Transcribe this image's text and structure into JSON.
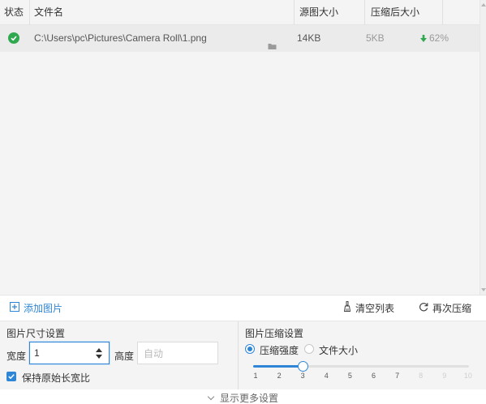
{
  "table": {
    "headers": {
      "status": "状态",
      "filename": "文件名",
      "original_size": "源图大小",
      "compressed_size": "压缩后大小"
    },
    "rows": [
      {
        "status": "success",
        "path": "C:\\Users\\pc\\Pictures\\Camera Roll\\1.png",
        "original_size": "14KB",
        "compressed_size": "5KB",
        "ratio": "62%"
      }
    ]
  },
  "toolbar": {
    "add_label": "添加图片",
    "clear_label": "清空列表",
    "recompress_label": "再次压缩"
  },
  "size_settings": {
    "title": "图片尺寸设置",
    "width_label": "宽度",
    "width_value": "1",
    "height_label": "高度",
    "height_placeholder": "自动",
    "keep_ratio_label": "保持原始长宽比",
    "keep_ratio_checked": true
  },
  "compress_settings": {
    "title": "图片压缩设置",
    "mode_strength_label": "压缩强度",
    "mode_filesize_label": "文件大小",
    "selected_mode": "strength",
    "level_value": 3,
    "levels": [
      "1",
      "2",
      "3",
      "4",
      "5",
      "6",
      "7",
      "8",
      "9",
      "10"
    ]
  },
  "more_settings_label": "显示更多设置",
  "colors": {
    "accent": "#2f86d6",
    "success": "#2fa84f",
    "panel_bg": "#f4f4f4"
  },
  "icons": {
    "status_ok": "check-circle-icon",
    "folder": "folder-icon",
    "add": "plus-square-icon",
    "clear": "broom-icon",
    "recompress": "refresh-icon",
    "expand": "chevron-down-icon"
  }
}
